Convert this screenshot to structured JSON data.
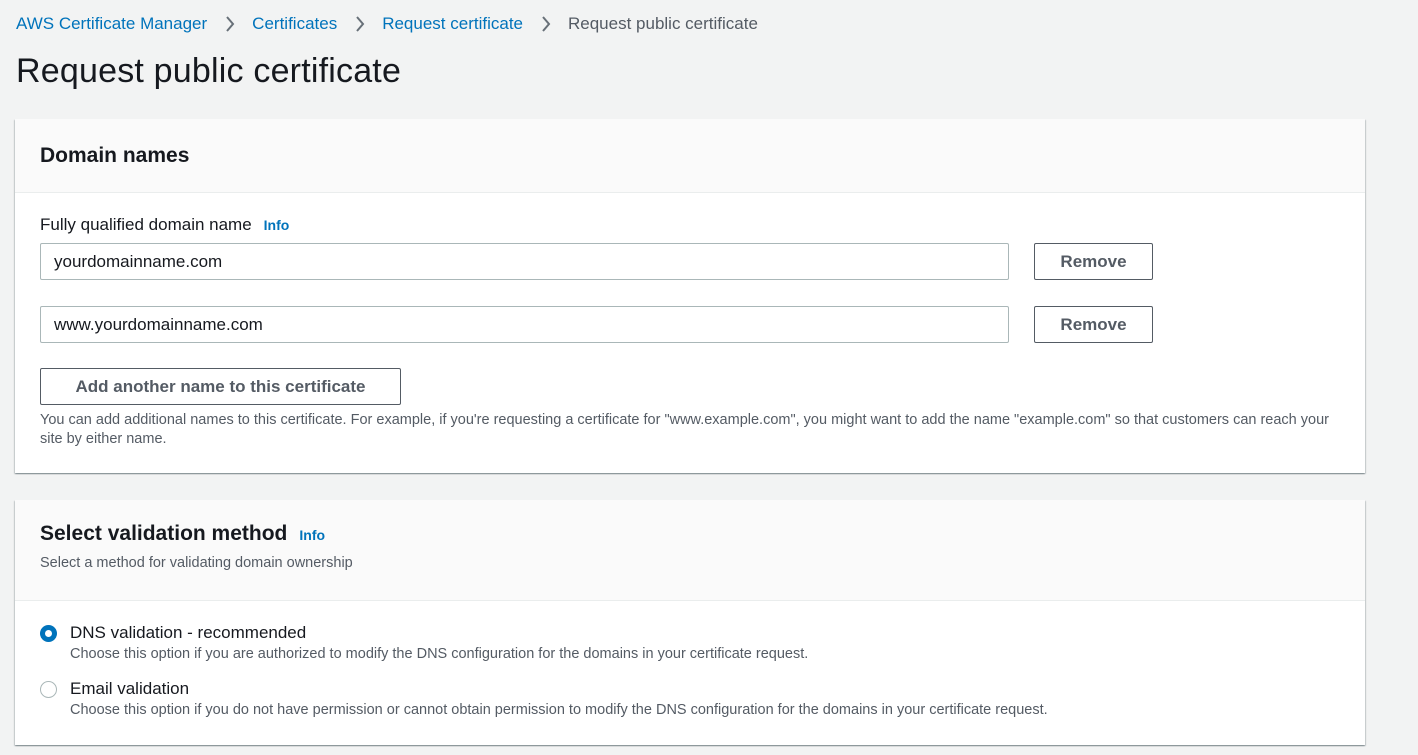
{
  "breadcrumb": {
    "items": [
      "AWS Certificate Manager",
      "Certificates",
      "Request certificate"
    ],
    "current": "Request public certificate"
  },
  "page": {
    "title": "Request public certificate"
  },
  "domain_names": {
    "title": "Domain names",
    "field_label": "Fully qualified domain name",
    "info": "Info",
    "domains": [
      "yourdomainname.com",
      "www.yourdomainname.com"
    ],
    "remove_label": "Remove",
    "add_label": "Add another name to this certificate",
    "help": "You can add additional names to this certificate. For example, if you're requesting a certificate for \"www.example.com\", you might want to add the name \"example.com\" so that customers can reach your site by either name."
  },
  "validation": {
    "title": "Select validation method",
    "info": "Info",
    "description": "Select a method for validating domain ownership",
    "options": [
      {
        "label": "DNS validation - recommended",
        "description": "Choose this option if you are authorized to modify the DNS configuration for the domains in your certificate request.",
        "selected": true
      },
      {
        "label": "Email validation",
        "description": "Choose this option if you do not have permission or cannot obtain permission to modify the DNS configuration for the domains in your certificate request.",
        "selected": false
      }
    ]
  },
  "colors": {
    "link": "#0073bb",
    "background": "#f2f3f3",
    "text": "#16191f",
    "secondary_text": "#545b64",
    "border": "#aab7b8"
  },
  "icons": {
    "breadcrumb_separator": "chevron-right-icon"
  }
}
